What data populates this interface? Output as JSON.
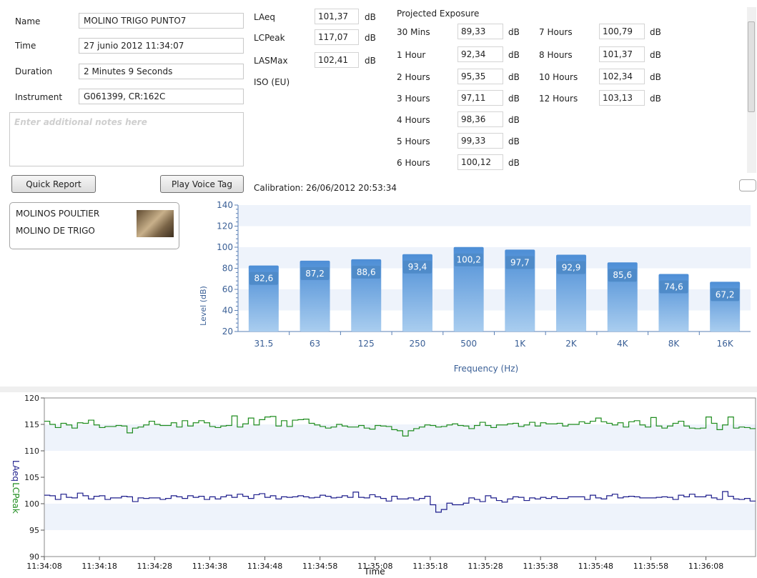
{
  "info": {
    "name_label": "Name",
    "name_value": "MOLINO TRIGO PUNTO7",
    "time_label": "Time",
    "time_value": "27 junio 2012 11:34:07",
    "duration_label": "Duration",
    "duration_value": "2 Minutes 9 Seconds",
    "instrument_label": "Instrument",
    "instrument_value": "G061399, CR:162C",
    "notes_placeholder": "Enter additional notes here"
  },
  "buttons": {
    "quick_report": "Quick Report",
    "play_voice_tag": "Play Voice Tag"
  },
  "location": {
    "line1": "MOLINOS POULTIER",
    "line2": "MOLINO DE TRIGO"
  },
  "metrics": {
    "unit": "dB",
    "rows": [
      {
        "label": "LAeq",
        "value": "101,37"
      },
      {
        "label": "LCPeak",
        "value": "117,07"
      },
      {
        "label": "LASMax",
        "value": "102,41"
      }
    ],
    "iso_label": "ISO (EU)"
  },
  "exposure": {
    "title": "Projected Exposure",
    "unit": "dB",
    "col1": [
      {
        "label": "30 Mins",
        "value": "89,33"
      },
      {
        "label": "1 Hour",
        "value": "92,34"
      },
      {
        "label": "2 Hours",
        "value": "95,35"
      },
      {
        "label": "3 Hours",
        "value": "97,11"
      },
      {
        "label": "4 Hours",
        "value": "98,36"
      },
      {
        "label": "5 Hours",
        "value": "99,33"
      },
      {
        "label": "6 Hours",
        "value": "100,12"
      }
    ],
    "col2": [
      {
        "label": "7 Hours",
        "value": "100,79"
      },
      {
        "label": "8 Hours",
        "value": "101,37"
      },
      {
        "label": "10 Hours",
        "value": "102,34"
      },
      {
        "label": "12 Hours",
        "value": "103,13"
      }
    ]
  },
  "calibration": "Calibration: 26/06/2012 20:53:34",
  "chart_data": [
    {
      "type": "bar",
      "categories": [
        "31.5",
        "63",
        "125",
        "250",
        "500",
        "1K",
        "2K",
        "4K",
        "8K",
        "16K"
      ],
      "values": [
        82.6,
        87.2,
        88.6,
        93.4,
        100.2,
        97.7,
        92.9,
        85.6,
        74.6,
        67.2
      ],
      "value_labels": [
        "82,6",
        "87,2",
        "88,6",
        "93,4",
        "100,2",
        "97,7",
        "92,9",
        "85,6",
        "74,6",
        "67,2"
      ],
      "ylabel": "Level (dB)",
      "xlabel": "Frequency (Hz)",
      "ylim": [
        20,
        140
      ],
      "yticks": [
        20,
        40,
        60,
        80,
        100,
        120,
        140
      ],
      "colors": {
        "bar": "#5b9bd5",
        "band": "#eef3fb"
      }
    },
    {
      "type": "line",
      "xlabel": "Time",
      "ylabel_series": [
        "LAeq",
        "LCPeak"
      ],
      "ylim": [
        90,
        120
      ],
      "yticks": [
        90,
        95,
        100,
        105,
        110,
        115,
        120
      ],
      "xticks": [
        "11:34:08",
        "11:34:18",
        "11:34:28",
        "11:34:38",
        "11:34:48",
        "11:34:58",
        "11:35:08",
        "11:35:18",
        "11:35:28",
        "11:35:38",
        "11:35:48",
        "11:35:58",
        "11:36:08"
      ],
      "x_range_seconds": [
        0,
        129
      ],
      "series": [
        {
          "name": "LCPeak",
          "color": "#1e8c1e",
          "values": [
            115.6,
            115.0,
            114.4,
            115.2,
            114.9,
            114.3,
            115.3,
            115.2,
            115.8,
            114.9,
            114.4,
            114.6,
            114.6,
            114.8,
            114.7,
            113.4,
            114.3,
            114.5,
            114.9,
            115.6,
            115.0,
            114.8,
            114.8,
            115.3,
            114.5,
            115.7,
            114.7,
            115.3,
            115.7,
            115.3,
            114.6,
            114.4,
            114.7,
            114.8,
            116.6,
            114.5,
            115.1,
            116.2,
            114.9,
            115.9,
            116.4,
            116.5,
            114.7,
            115.7,
            114.6,
            115.8,
            115.9,
            116.0,
            115.2,
            114.9,
            114.6,
            114.3,
            114.5,
            115.0,
            114.7,
            114.5,
            114.5,
            114.8,
            114.3,
            114.1,
            114.8,
            114.7,
            114.6,
            114.0,
            113.8,
            112.8,
            113.8,
            114.2,
            114.5,
            114.9,
            114.8,
            114.5,
            114.6,
            114.9,
            115.1,
            114.8,
            114.7,
            114.2,
            114.8,
            115.4,
            114.8,
            114.4,
            114.9,
            114.9,
            115.1,
            115.2,
            114.6,
            114.9,
            115.4,
            114.7,
            115.3,
            115.1,
            115.1,
            115.2,
            114.7,
            115.0,
            115.0,
            115.5,
            115.2,
            115.6,
            116.2,
            115.5,
            115.2,
            114.9,
            115.3,
            114.5,
            115.5,
            115.7,
            114.9,
            114.5,
            116.3,
            114.7,
            114.3,
            114.7,
            115.2,
            115.6,
            114.7,
            114.3,
            114.2,
            114.3,
            116.4,
            115.2,
            114.0,
            114.9,
            116.4,
            114.3,
            114.5,
            114.4,
            114.2
          ]
        },
        {
          "name": "LAeq",
          "color": "#1e1e8c",
          "values": [
            101.6,
            101.5,
            100.8,
            101.8,
            101.2,
            101.1,
            102.0,
            101.5,
            100.9,
            101.4,
            101.5,
            100.8,
            101.1,
            101.1,
            101.4,
            101.3,
            100.4,
            101.1,
            101.0,
            101.1,
            101.1,
            100.8,
            101.0,
            101.5,
            101.3,
            101.0,
            101.5,
            101.2,
            101.4,
            100.8,
            101.3,
            100.9,
            101.3,
            101.6,
            101.2,
            101.8,
            101.4,
            101.0,
            101.7,
            101.9,
            101.2,
            101.5,
            100.9,
            101.3,
            101.2,
            101.3,
            101.5,
            101.3,
            101.1,
            101.2,
            101.6,
            101.4,
            101.1,
            101.2,
            101.5,
            101.2,
            102.2,
            101.2,
            101.1,
            101.7,
            101.3,
            101.0,
            100.5,
            101.4,
            100.9,
            100.9,
            101.1,
            100.7,
            101.0,
            101.4,
            99.8,
            98.4,
            98.9,
            100.1,
            99.8,
            99.8,
            100.1,
            101.1,
            100.8,
            100.4,
            101.5,
            101.1,
            100.6,
            100.3,
            100.9,
            101.3,
            101.2,
            100.6,
            101.1,
            100.9,
            101.2,
            101.0,
            101.3,
            101.0,
            101.0,
            101.3,
            101.3,
            101.3,
            100.8,
            101.6,
            101.1,
            100.9,
            101.5,
            101.8,
            101.1,
            101.3,
            101.4,
            101.3,
            101.1,
            101.1,
            101.1,
            101.2,
            101.3,
            101.2,
            100.8,
            101.6,
            101.3,
            101.8,
            101.3,
            101.3,
            101.6,
            101.1,
            100.8,
            102.3,
            101.4,
            100.9,
            100.8,
            101.0,
            100.5
          ]
        }
      ]
    }
  ]
}
